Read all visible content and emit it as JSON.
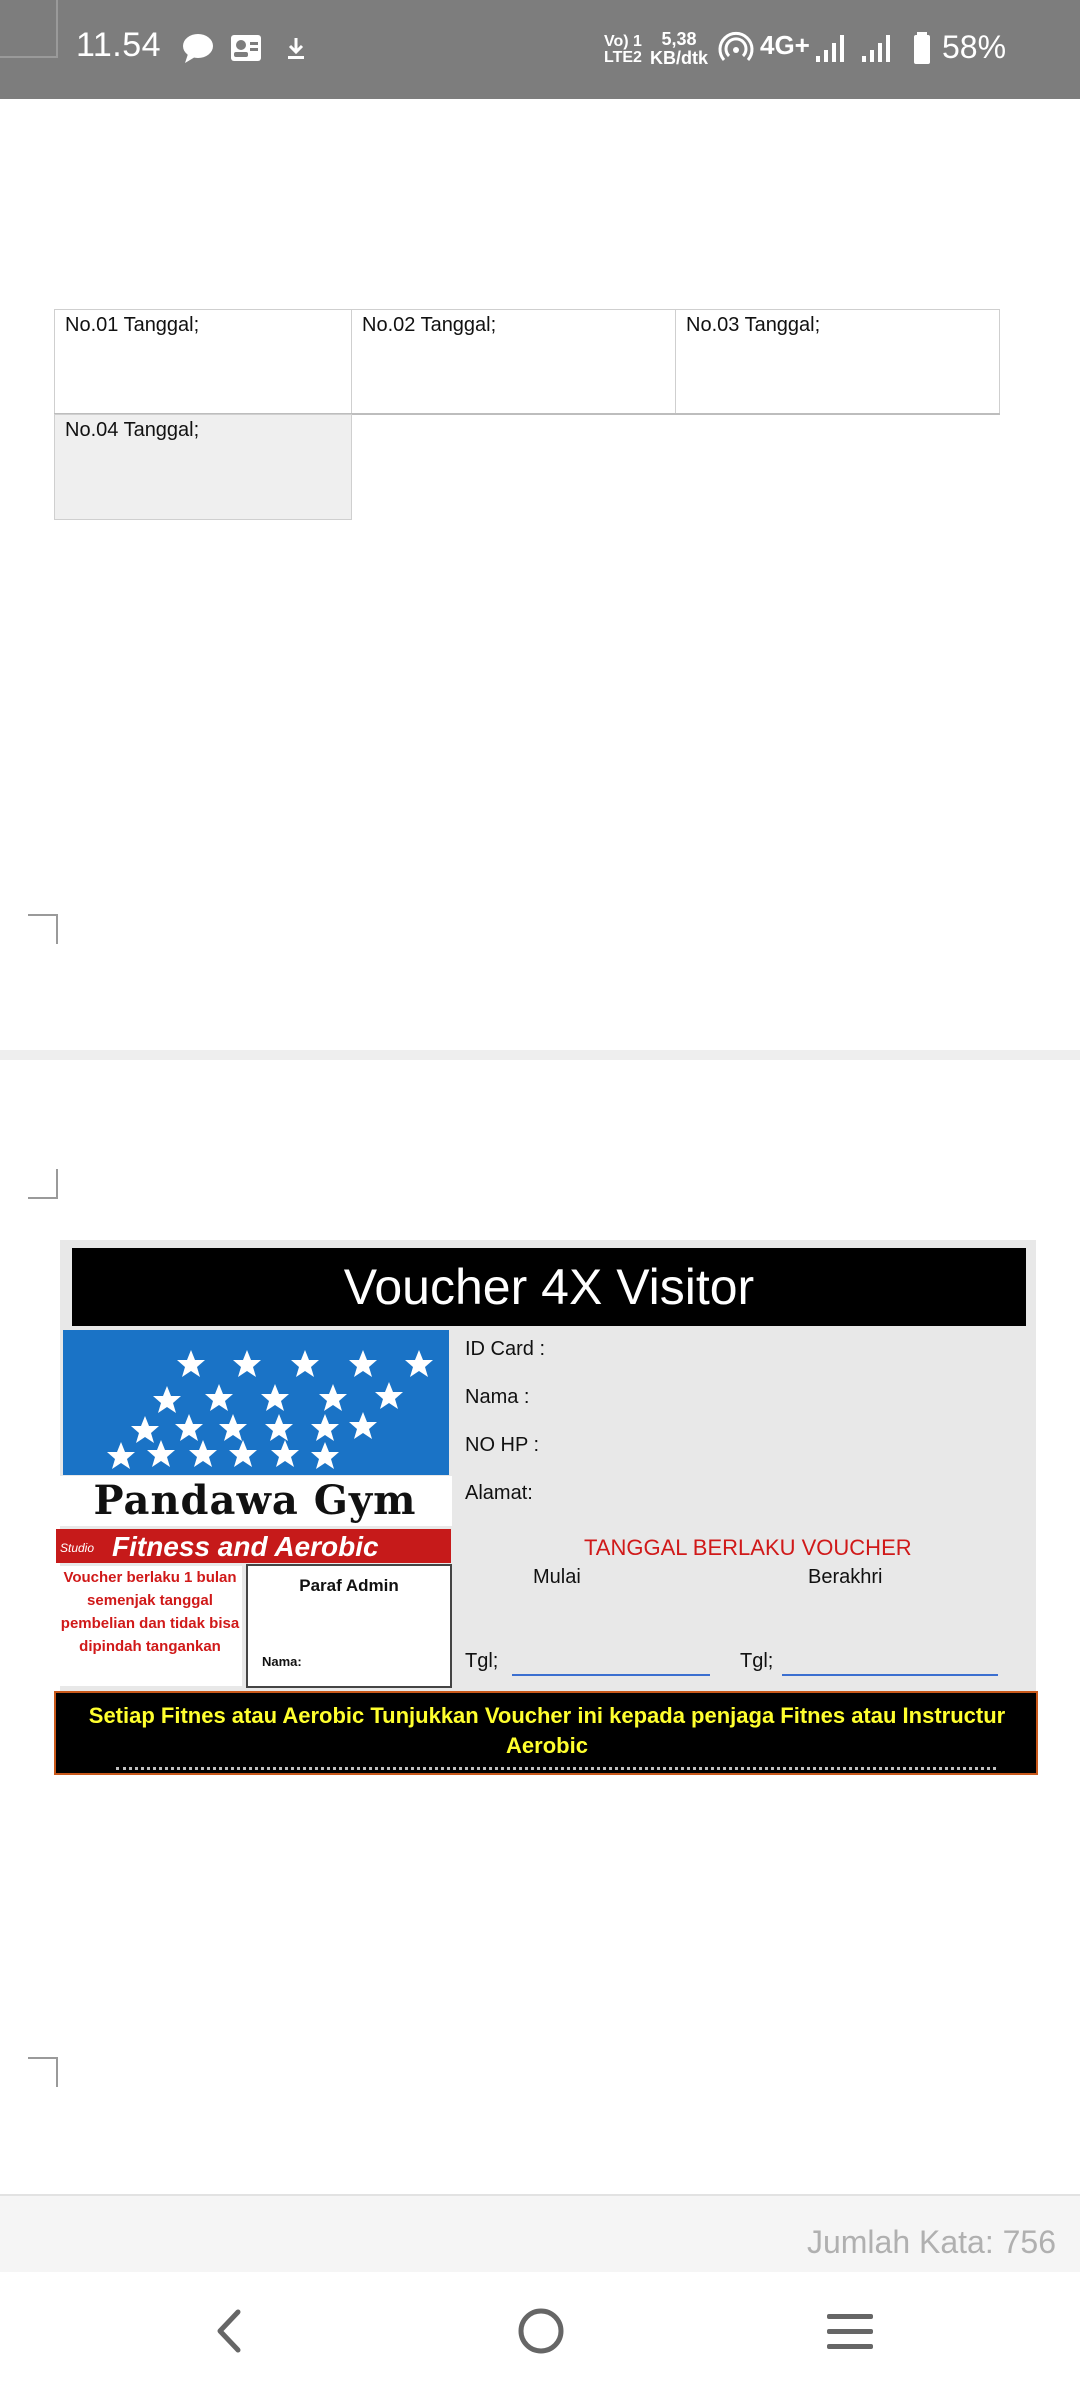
{
  "status_bar": {
    "time": "11.54",
    "volte_top": "Vo) 1",
    "volte_bottom": "LTE2",
    "speed_value": "5,38",
    "speed_unit": "KB/dtk",
    "network": "4G+",
    "battery": "58%",
    "icons": [
      "chat-icon",
      "contact-card-icon",
      "download-icon",
      "hotspot-icon",
      "signal-icon",
      "signal-icon",
      "battery-icon"
    ]
  },
  "table": {
    "row1": [
      "No.01 Tanggal;",
      "No.02 Tanggal;",
      "No.03 Tanggal;"
    ],
    "row2": [
      "No.04 Tanggal;"
    ]
  },
  "voucher": {
    "title": "Voucher 4X Visitor",
    "logo_name": "Pandawa Gym",
    "logo_studio": "Studio",
    "logo_tagline": "Fitness and Aerobic",
    "note": "Voucher berlaku 1 bulan semenjak tanggal pembelian dan tidak bisa dipindah tangankan",
    "paraf_title": "Paraf Admin",
    "paraf_nama": "Nama:",
    "fields": {
      "id_card": "ID Card :",
      "nama": "Nama  :",
      "no_hp": "NO HP :",
      "alamat": "Alamat:"
    },
    "validity_heading": "TANGGAL BERLAKU VOUCHER",
    "start_label": "Mulai",
    "end_label": "Berakhri",
    "tgl_label": "Tgl;",
    "footer_message": "Setiap Fitnes atau Aerobic Tunjukkan Voucher ini kepada penjaga Fitnes atau Instructur Aerobic"
  },
  "word_count": "Jumlah Kata: 756",
  "nav": {
    "icons": [
      "back-icon",
      "home-icon",
      "menu-icon"
    ]
  },
  "colors": {
    "status_bar": "#7d7d7d",
    "voucher_red": "#d01919",
    "logo_blue": "#1a73c6",
    "footer_text": "#ffff2e"
  }
}
